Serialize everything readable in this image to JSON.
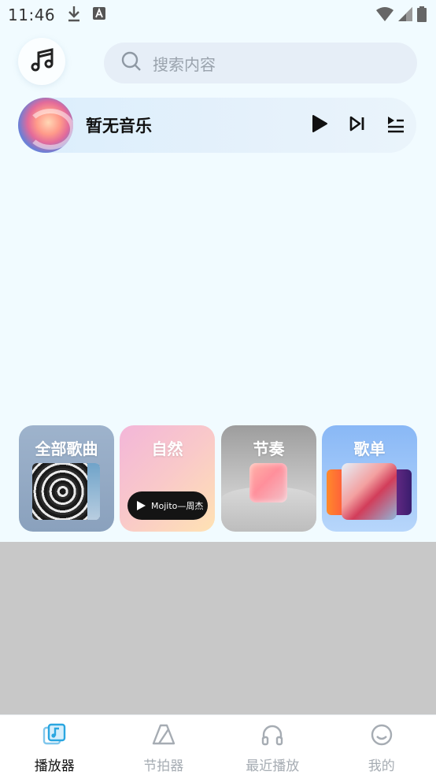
{
  "status_bar": {
    "time": "11:46"
  },
  "search": {
    "placeholder": "搜索内容"
  },
  "player": {
    "title": "暂无音乐"
  },
  "categories": [
    {
      "label": "全部歌曲"
    },
    {
      "label": "自然",
      "song": "Mojito—周杰"
    },
    {
      "label": "节奏"
    },
    {
      "label": "歌单"
    }
  ],
  "bottom_nav": {
    "items": [
      {
        "label": "播放器",
        "icon": "music-note-icon",
        "active": true
      },
      {
        "label": "节拍器",
        "icon": "metronome-icon"
      },
      {
        "label": "最近播放",
        "icon": "headphones-icon"
      },
      {
        "label": "我的",
        "icon": "smiley-icon"
      }
    ]
  },
  "colors": {
    "accent": "#2aa6e0",
    "background": "#f1fbff"
  }
}
